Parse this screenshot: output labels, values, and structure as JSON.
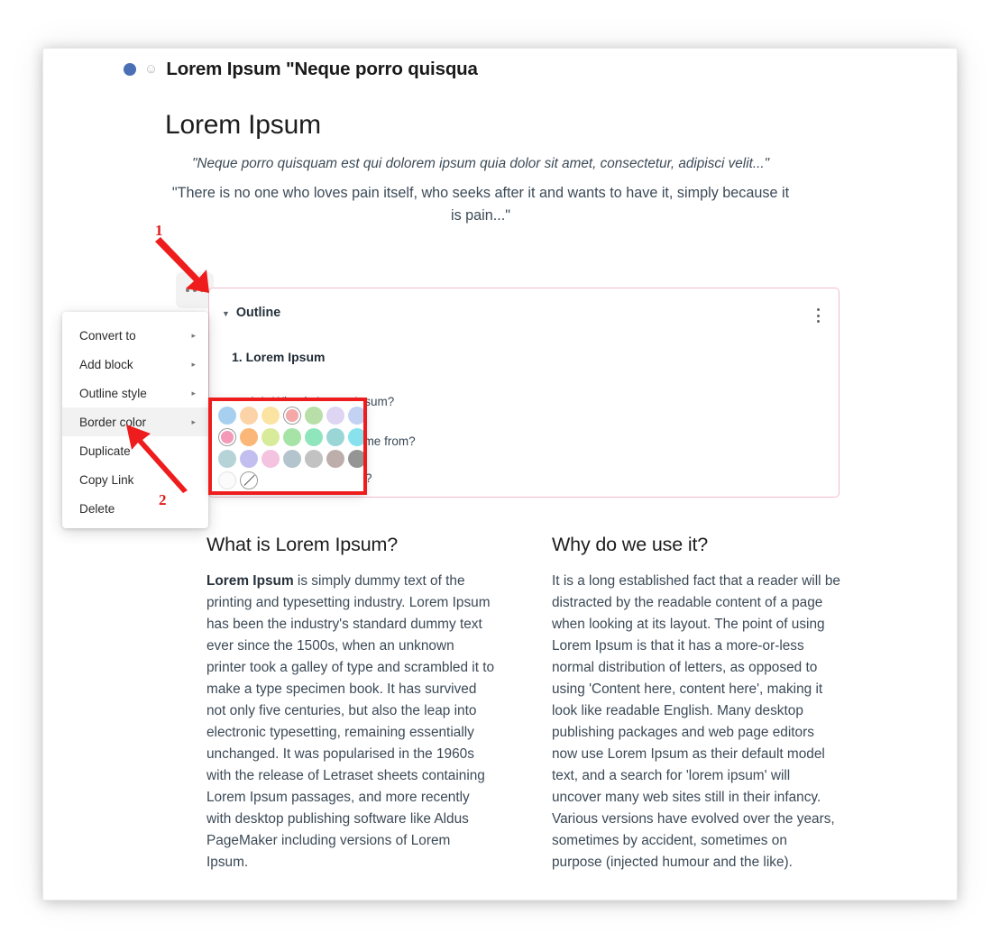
{
  "breadcrumb": {
    "dot_color": "#4a6fb5",
    "emoji_icon": "smiley-icon",
    "emoji_glyph": "☺",
    "title": "Lorem Ipsum \"Neque porro quisqua"
  },
  "page": {
    "title": "Lorem Ipsum",
    "quote_1": "\"Neque porro quisquam est qui dolorem ipsum quia dolor sit amet, consectetur, adipisci velit...\"",
    "quote_2": "\"There is no one who loves pain itself, who seeks after it and wants to have it, simply because it is pain...\""
  },
  "block_handle": {
    "icon": "ellipsis-handle-icon",
    "label": "..."
  },
  "outline_panel": {
    "caret": "▼",
    "label": "Outline",
    "border_color": "#f0bcd0",
    "kebab_icon": "vertical-ellipsis-icon",
    "items": [
      {
        "level": 1,
        "text": "1. Lorem Ipsum"
      },
      {
        "level": 2,
        "text": "1.1. What is Lorem Ipsum?"
      },
      {
        "level": 2,
        "text": "1.2. Where does it come from?"
      },
      {
        "level": 2,
        "text": "1.3. Why do we use it?"
      }
    ]
  },
  "context_menu": {
    "items": [
      {
        "label": "Convert to",
        "submenu": true,
        "highlight": false
      },
      {
        "label": "Add block",
        "submenu": true,
        "highlight": false
      },
      {
        "label": "Outline style",
        "submenu": true,
        "highlight": false
      },
      {
        "label": "Border color",
        "submenu": true,
        "highlight": true
      },
      {
        "label": "Duplicate",
        "submenu": false,
        "highlight": false
      },
      {
        "label": "Copy Link",
        "submenu": false,
        "highlight": false
      },
      {
        "label": "Delete",
        "submenu": false,
        "highlight": false
      }
    ],
    "submenu_arrow": "▸"
  },
  "color_popup": {
    "rows": [
      [
        {
          "name": "light-blue",
          "hex": "#a7d0f0",
          "selected": false
        },
        {
          "name": "light-orange",
          "hex": "#fbd3a7",
          "selected": false
        },
        {
          "name": "light-yellow",
          "hex": "#fbe3a2",
          "selected": false
        },
        {
          "name": "salmon",
          "hex": "#f5a8a8",
          "selected": true
        },
        {
          "name": "light-green",
          "hex": "#b8dfa8",
          "selected": false
        },
        {
          "name": "lavender",
          "hex": "#ded5f2",
          "selected": false
        },
        {
          "name": "periwinkle",
          "hex": "#c3d2f2",
          "selected": false
        }
      ],
      [
        {
          "name": "pink",
          "hex": "#f49ab8",
          "selected": true
        },
        {
          "name": "orange",
          "hex": "#fbb777",
          "selected": false
        },
        {
          "name": "lime",
          "hex": "#d8eb9a",
          "selected": false
        },
        {
          "name": "mint-green",
          "hex": "#a5e3a6",
          "selected": false
        },
        {
          "name": "spring-green",
          "hex": "#8fe6bd",
          "selected": false
        },
        {
          "name": "teal",
          "hex": "#9ad6d6",
          "selected": false
        },
        {
          "name": "cyan",
          "hex": "#87e2ee",
          "selected": false
        }
      ],
      [
        {
          "name": "pale-teal",
          "hex": "#b6d3d8",
          "selected": false
        },
        {
          "name": "light-purple",
          "hex": "#c3bef0",
          "selected": false
        },
        {
          "name": "light-pink",
          "hex": "#f4c3e0",
          "selected": false
        },
        {
          "name": "blue-gray",
          "hex": "#b3c4cc",
          "selected": false
        },
        {
          "name": "gray",
          "hex": "#c2c2c2",
          "selected": false
        },
        {
          "name": "warm-gray",
          "hex": "#bdaeab",
          "selected": false
        },
        {
          "name": "dark-gray",
          "hex": "#959595",
          "selected": false
        }
      ],
      [
        {
          "name": "white",
          "hex": "#fbfbfb",
          "selected": false,
          "style": "white"
        },
        {
          "name": "no-color",
          "hex": "#ffffff",
          "selected": false,
          "style": "none"
        }
      ]
    ]
  },
  "annotations": {
    "color": "#ee1c1c",
    "marker_1": "1",
    "marker_2": "2"
  },
  "columns": {
    "left": {
      "heading": "What is Lorem Ipsum?",
      "lead": "Lorem Ipsum",
      "body": " is simply dummy text of the printing and typesetting industry. Lorem Ipsum has been the industry's standard dummy text ever since the 1500s, when an unknown printer took a galley of type and scrambled it to make a type specimen book. It has survived not only five centuries, but also the leap into electronic typesetting, remaining essentially unchanged. It was popularised in the 1960s with the release of Letraset sheets containing Lorem Ipsum passages, and more recently with desktop publishing software like Aldus PageMaker including versions of Lorem Ipsum."
    },
    "right": {
      "heading": "Why do we use it?",
      "body": "It is a long established fact that a reader will be distracted by the readable content of a page when looking at its layout. The point of using Lorem Ipsum is that it has a more-or-less normal distribution of letters, as opposed to using 'Content here, content here', making it look like readable English. Many desktop publishing packages and web page editors now use Lorem Ipsum as their default model text, and a search for 'lorem ipsum' will uncover many web sites still in their infancy. Various versions have evolved over the years, sometimes by accident, sometimes on purpose (injected humour and the like)."
    }
  }
}
